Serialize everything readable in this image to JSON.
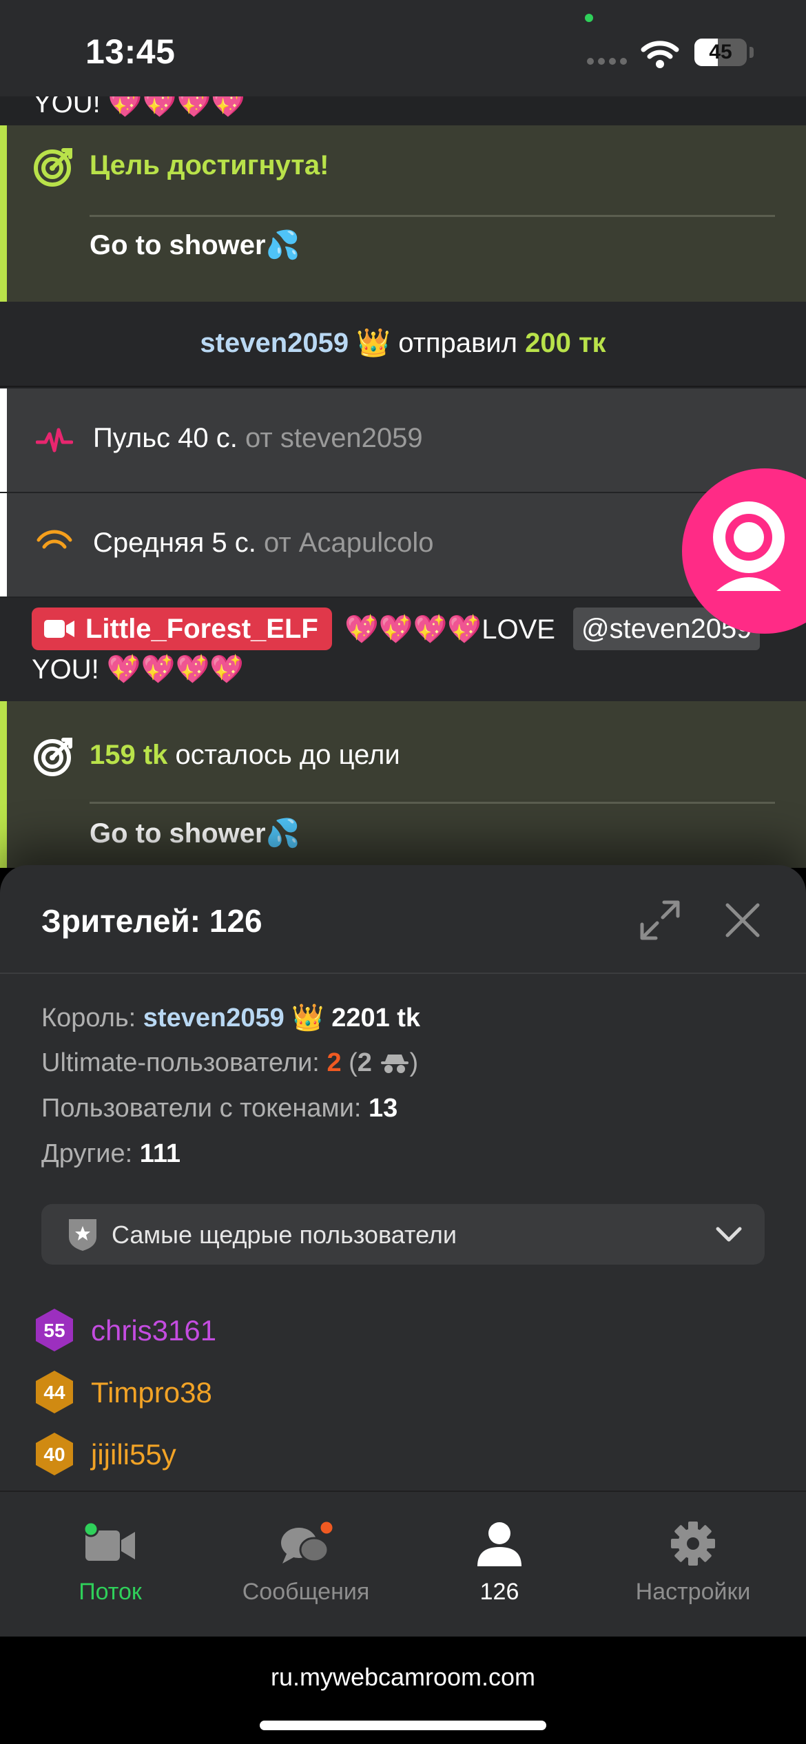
{
  "status_bar": {
    "time": "13:45",
    "battery": "45",
    "battery_level_pct": 45
  },
  "chat": {
    "partial_message": "YOU! 💖💖💖💖",
    "goal_reached": {
      "title": "Цель достигнута!",
      "goal": "Go to shower💦"
    },
    "tip": {
      "user": "steven2059",
      "crown": "👑",
      "verb": "отправил",
      "amount": "200 тк"
    },
    "activity": [
      {
        "name": "Пульс 40 с.",
        "from_label": "от",
        "user": "steven2059",
        "icon": "pulse-icon",
        "color": "#e8266f"
      },
      {
        "name": "Средняя 5 с.",
        "from_label": "от",
        "user": "Acapulcolo",
        "icon": "vibration-wave-icon",
        "color": "#f59f1c"
      }
    ],
    "message": {
      "sender": "Little_Forest_ELF",
      "text": "💖💖💖💖LOVE",
      "mention": "@steven2059",
      "line2": "YOU! 💖💖💖💖"
    },
    "goal_progress": {
      "tokens": "159 tk",
      "text": "осталось до цели",
      "goal": "Go to shower💦"
    }
  },
  "sheet": {
    "title": "Зрителей: 126",
    "king_label": "Король:",
    "king_user": "steven2059",
    "king_tokens": "2201 tk",
    "ultimate_label": "Ultimate-пользователи:",
    "ultimate_count": "2",
    "ultimate_hidden": "2",
    "token_users_label": "Пользователи с токенами:",
    "token_users_count": "13",
    "others_label": "Другие:",
    "others_count": "111",
    "dropdown_label": "Самые щедрые пользователи",
    "users": [
      {
        "level": "55",
        "name": "chris3161",
        "color": "#c44ce0",
        "badge_color": "#9c2fbf"
      },
      {
        "level": "44",
        "name": "Timpro38",
        "color": "#f2a326",
        "badge_color": "#d08a12"
      },
      {
        "level": "40",
        "name": "jijili55y",
        "color": "#f2a326",
        "badge_color": "#d08a12"
      }
    ]
  },
  "tabbar": {
    "tabs": [
      {
        "label": "Поток",
        "icon": "video-camera-icon"
      },
      {
        "label": "Сообщения",
        "icon": "chat-bubbles-icon"
      },
      {
        "label": "126",
        "icon": "person-icon"
      },
      {
        "label": "Настройки",
        "icon": "gear-icon"
      }
    ]
  },
  "browser": {
    "url": "ru.mywebcamroom.com"
  },
  "colors": {
    "accent_green": "#b9e24a",
    "live_green": "#2fd05a",
    "pink": "#ff2b86",
    "badge_red": "#e0384a"
  }
}
